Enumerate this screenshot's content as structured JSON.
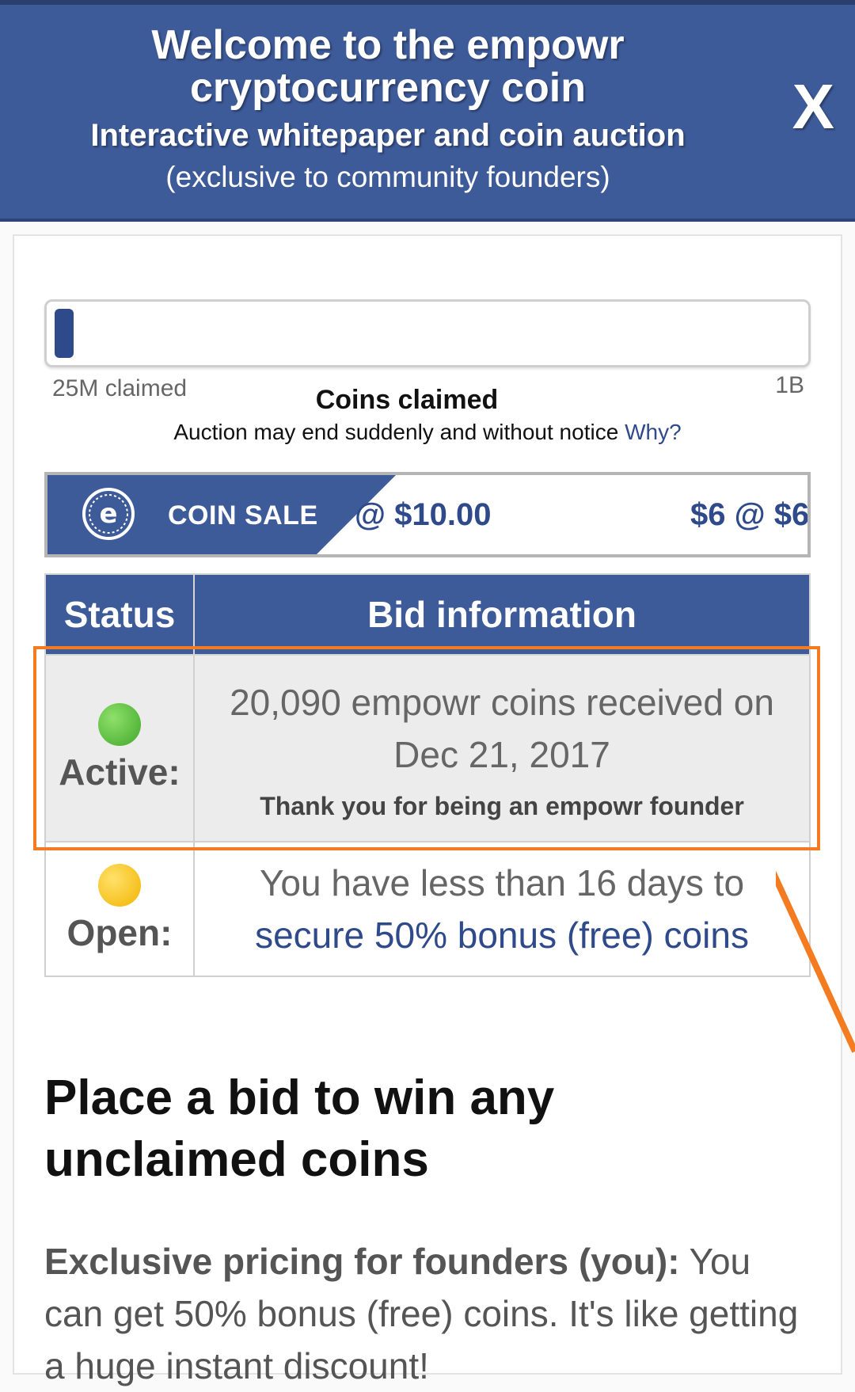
{
  "banner": {
    "title": "Welcome to the empowr cryptocurrency coin",
    "subtitle": "Interactive whitepaper and coin auction",
    "note": "(exclusive to community founders)",
    "close_label": "X"
  },
  "progress": {
    "claimed_fraction": 0.025,
    "min_label": "25M claimed",
    "max_label": "1B",
    "center_label": "Coins claimed",
    "notice": "Auction may end suddenly and without notice",
    "notice_link": "Why?"
  },
  "ticker": {
    "sale_label": "COIN SALE",
    "price": "@ $10.00",
    "price_next": "$6 @ $6."
  },
  "table": {
    "headers": [
      "Status",
      "Bid information"
    ],
    "rows": [
      {
        "status": "Active:",
        "status_color": "#3fa82a",
        "info": "20,090 empowr coins received on Dec 21, 2017",
        "subinfo": "Thank you for being an empowr founder"
      },
      {
        "status": "Open:",
        "status_color": "#f2b400",
        "info": "You have less than 16 days to",
        "link": "secure 50% bonus (free) coins"
      }
    ]
  },
  "content": {
    "headline": "Place a bid to win any unclaimed coins",
    "para_bold": "Exclusive pricing for founders (you):",
    "para_text": " You can get 50% bonus (free) coins. It's like getting a huge instant discount!"
  },
  "colors": {
    "brand": "#3d5a99",
    "highlight": "#f47b20"
  }
}
